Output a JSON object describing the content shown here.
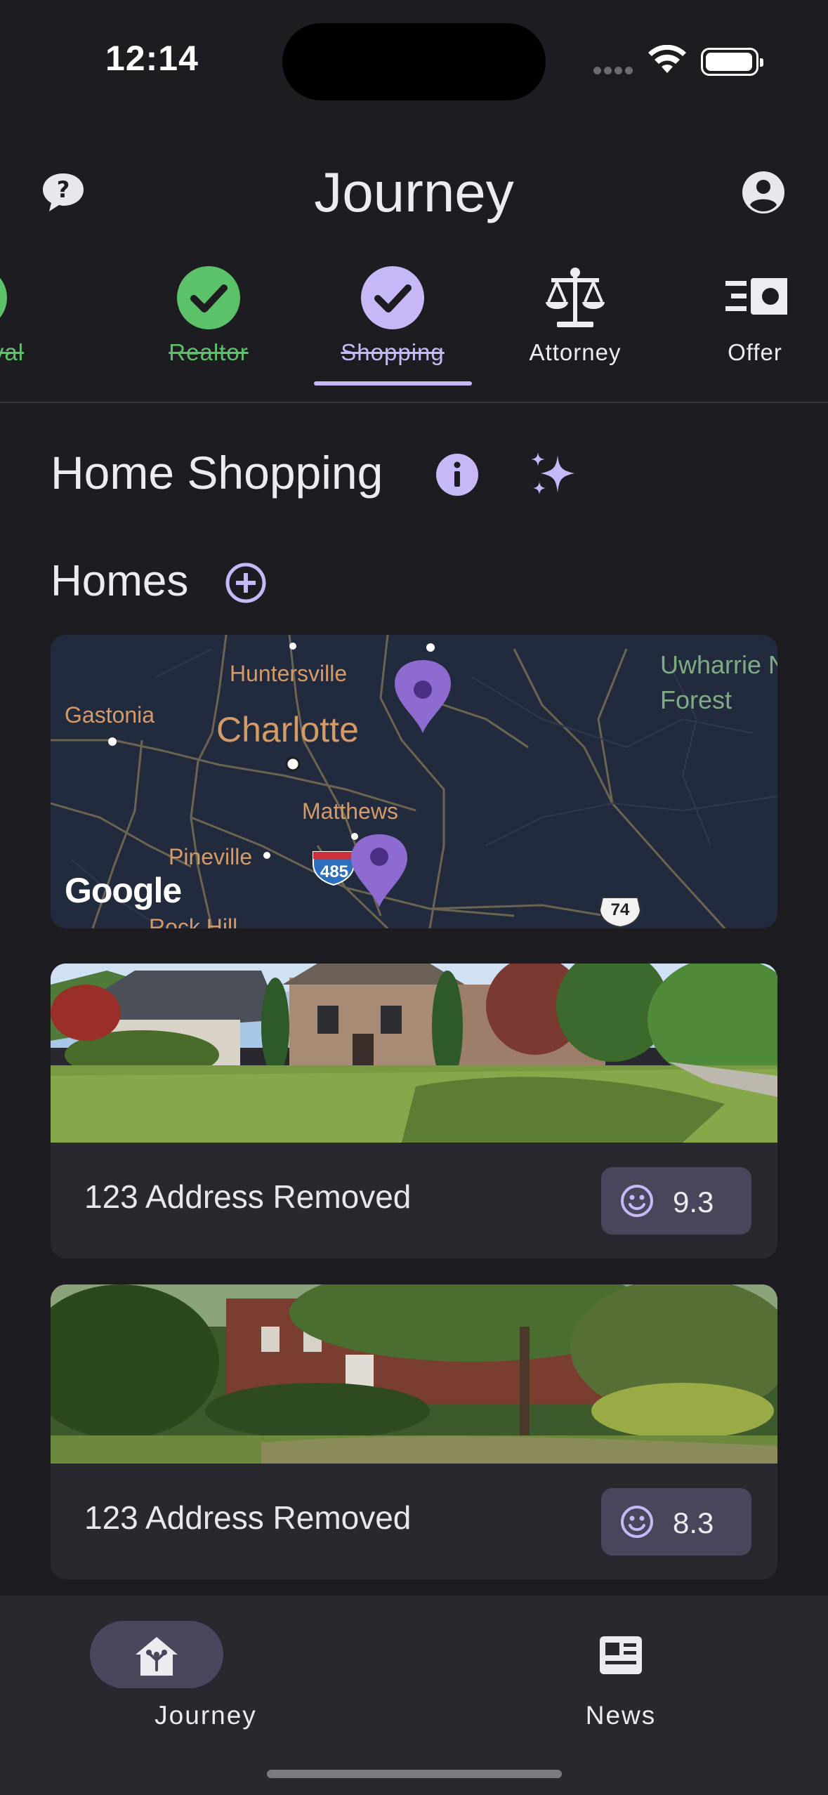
{
  "status": {
    "time": "12:14"
  },
  "header": {
    "title": "Journey"
  },
  "steps": [
    {
      "label": "Approval",
      "state": "done"
    },
    {
      "label": "Realtor",
      "state": "done"
    },
    {
      "label": "Shopping",
      "state": "active"
    },
    {
      "label": "Attorney",
      "state": "todo"
    },
    {
      "label": "Offer",
      "state": "todo"
    }
  ],
  "section": {
    "title": "Home Shopping",
    "homes_title": "Homes"
  },
  "map": {
    "labels": {
      "huntersville": "Huntersville",
      "gastonia": "Gastonia",
      "charlotte": "Charlotte",
      "matthews": "Matthews",
      "pineville": "Pineville",
      "rock_hill": "Rock Hill",
      "uwharrie": "Uwharrie National Forest",
      "i485": "485",
      "us74": "74"
    },
    "attribution": "Google",
    "pins": 2
  },
  "homes": [
    {
      "address": "123 Address Removed",
      "score": "9.3"
    },
    {
      "address": "123 Address Removed",
      "score": "8.3"
    }
  ],
  "nav": {
    "journey": "Journey",
    "news": "News"
  },
  "colors": {
    "accent": "#c7b8f7",
    "done": "#5cc26a",
    "pin": "#8e6bd1",
    "background": "#1d1c21"
  }
}
